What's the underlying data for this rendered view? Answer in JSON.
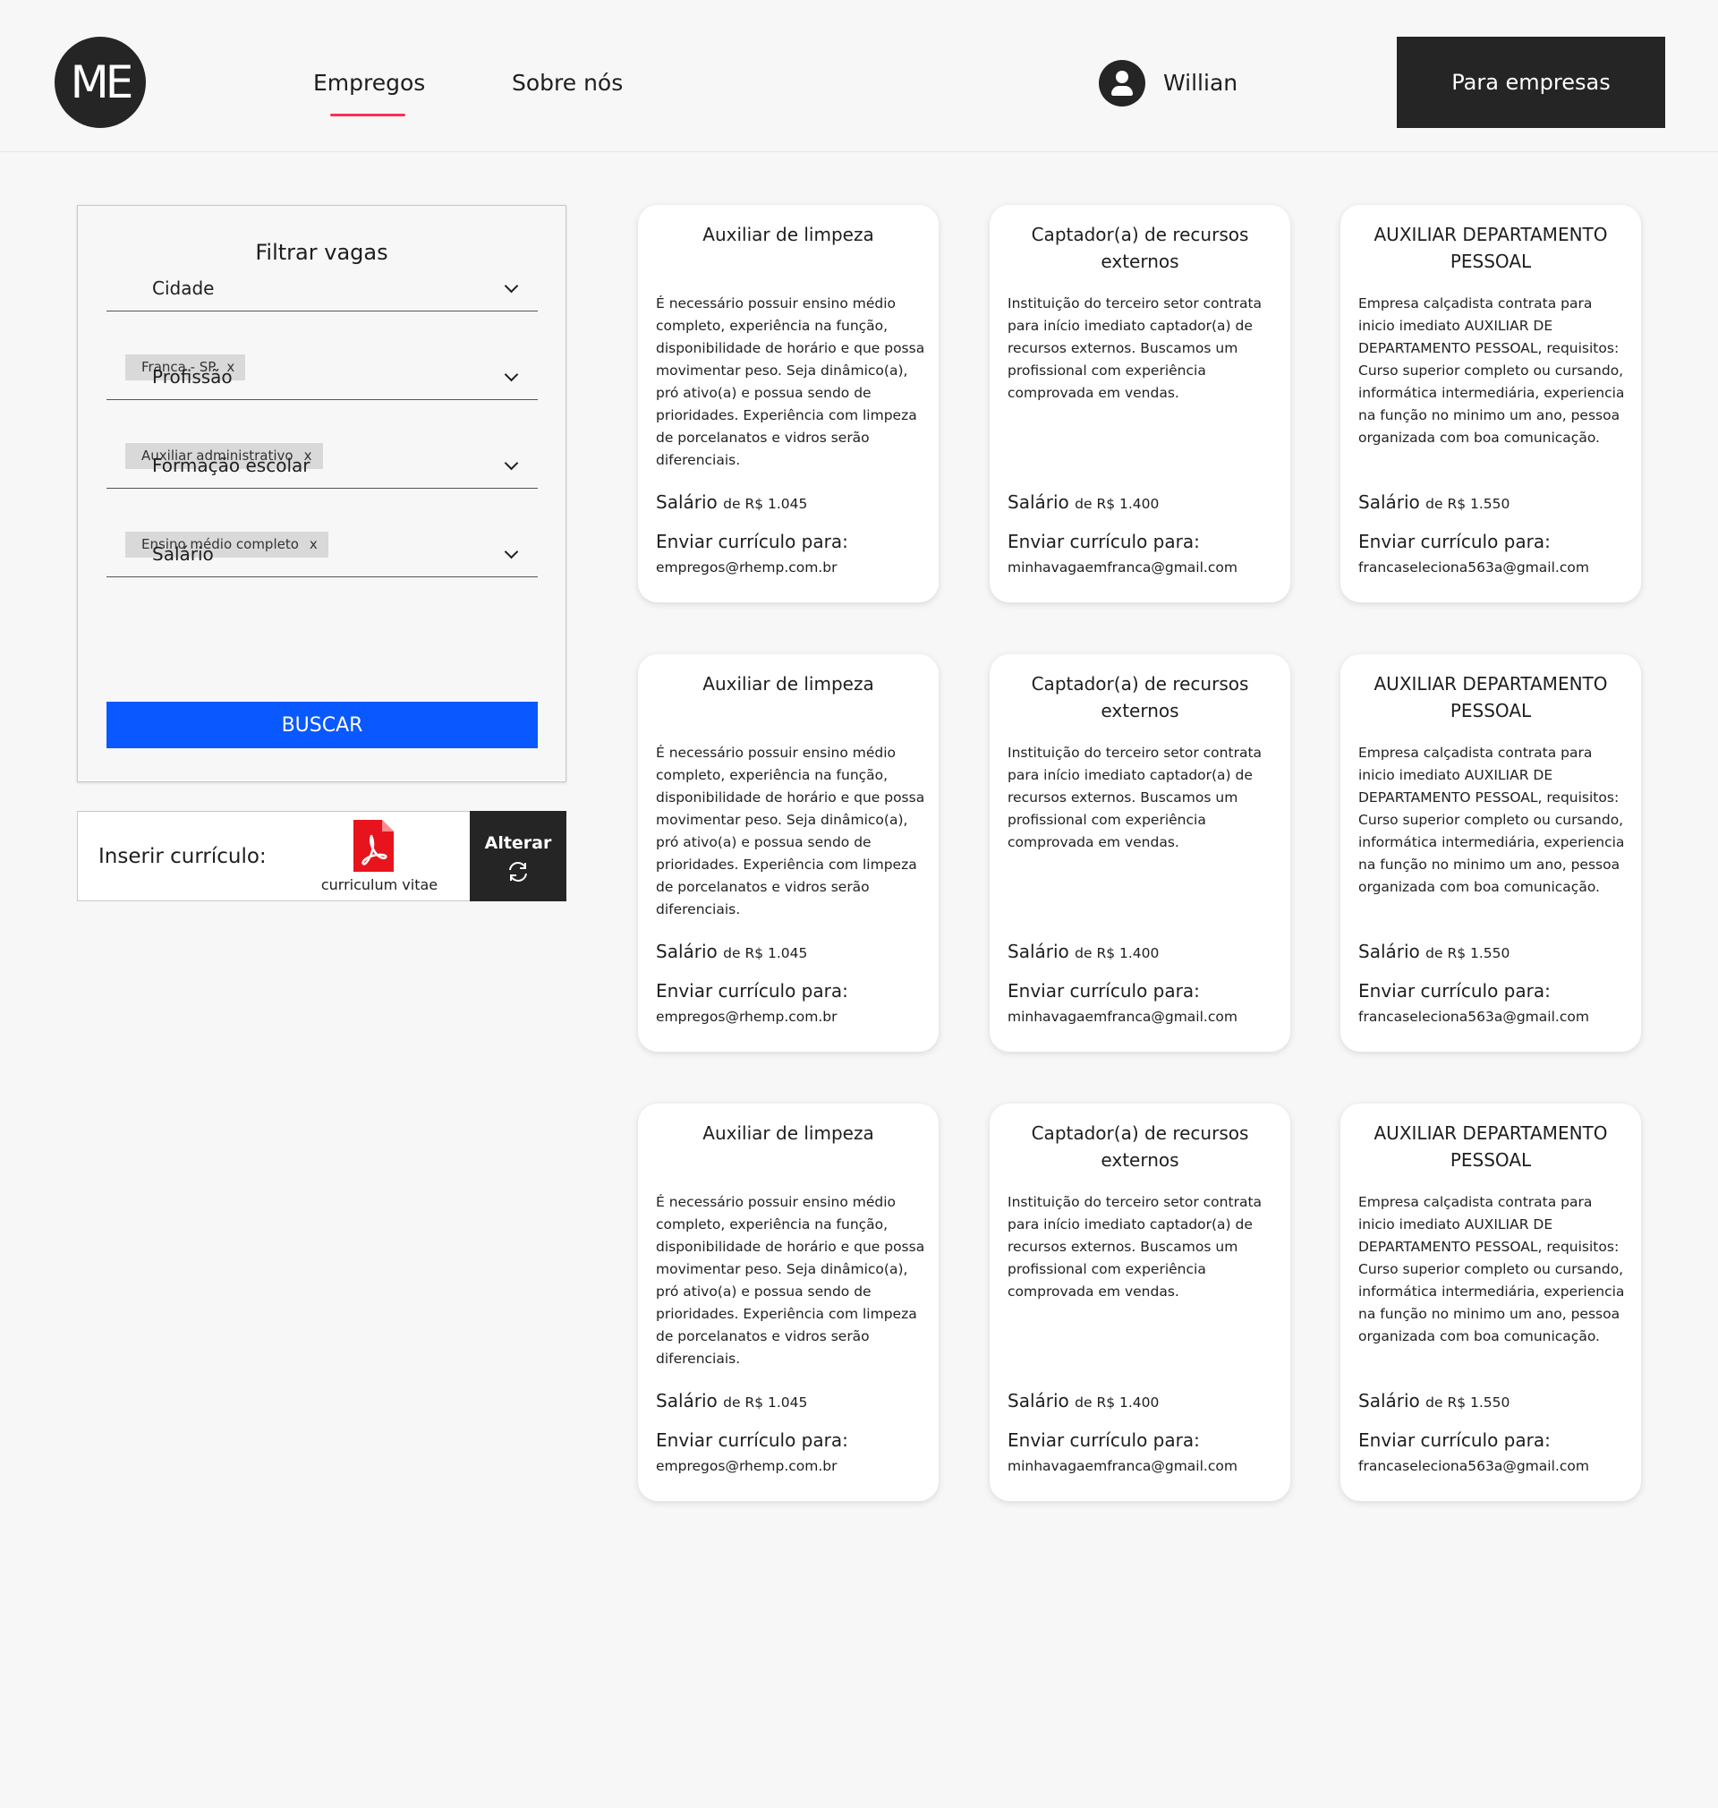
{
  "header": {
    "logo_text": "ME",
    "nav": [
      {
        "label": "Empregos",
        "active": true
      },
      {
        "label": "Sobre nós",
        "active": false
      }
    ],
    "user_name": "Willian",
    "cta_label": "Para empresas",
    "accent_color": "#ff2d55"
  },
  "filter": {
    "title": "Filtrar vagas",
    "fields": [
      {
        "label": "Cidade",
        "chip": "Franca - SP"
      },
      {
        "label": "Profissão",
        "chip": "Auxiliar administrativo"
      },
      {
        "label": "Formação escolar",
        "chip": "Ensino médio completo"
      },
      {
        "label": "Salário",
        "chip": null
      }
    ],
    "chip_remove": "x",
    "search_label": "BUSCAR",
    "search_color": "#0a58ff"
  },
  "cv": {
    "label": "Inserir currículo:",
    "file_name": "curriculum vitae",
    "change_label": "Alterar"
  },
  "job_labels": {
    "salary": "Salário",
    "send_to": "Enviar currículo para:"
  },
  "jobs": [
    {
      "title": "Auxiliar de limpeza",
      "description": "É necessário possuir ensino médio completo, experiência na função, disponibilidade de horário e que possa movimentar peso. Seja dinâmico(a), pró ativo(a) e possua sendo de prioridades. Experiência com limpeza de porcelanatos e vidros serão diferenciais.",
      "salary": "de R$ 1.045",
      "email": "empregos@rhemp.com.br"
    },
    {
      "title": "Captador(a) de recursos externos",
      "description": "Instituição do terceiro setor contrata para início imediato captador(a) de recursos externos. Buscamos um profissional com experiência comprovada em vendas.",
      "salary": "de R$ 1.400",
      "email": "minhavagaemfranca@gmail.com"
    },
    {
      "title": "AUXILIAR DEPARTAMENTO PESSOAL",
      "description": "Empresa calçadista contrata para inicio imediato AUXILIAR DE DEPARTAMENTO PESSOAL, requisitos: Curso superior completo ou cursando, informática intermediária, experiencia na função no minimo um ano, pessoa organizada com boa comunicação.",
      "salary": "de R$ 1.550",
      "email": "francaseleciona563a@gmail.com"
    },
    {
      "title": "Auxiliar de limpeza",
      "description": "É necessário possuir ensino médio completo, experiência na função, disponibilidade de horário e que possa movimentar peso. Seja dinâmico(a), pró ativo(a) e possua sendo de prioridades. Experiência com limpeza de porcelanatos e vidros serão diferenciais.",
      "salary": "de R$ 1.045",
      "email": "empregos@rhemp.com.br"
    },
    {
      "title": "Captador(a) de recursos externos",
      "description": "Instituição do terceiro setor contrata para início imediato captador(a) de recursos externos. Buscamos um profissional com experiência comprovada em vendas.",
      "salary": "de R$ 1.400",
      "email": "minhavagaemfranca@gmail.com"
    },
    {
      "title": "AUXILIAR DEPARTAMENTO PESSOAL",
      "description": "Empresa calçadista contrata para inicio imediato AUXILIAR DE DEPARTAMENTO PESSOAL, requisitos: Curso superior completo ou cursando, informática intermediária, experiencia na função no minimo um ano, pessoa organizada com boa comunicação.",
      "salary": "de R$ 1.550",
      "email": "francaseleciona563a@gmail.com"
    },
    {
      "title": "Auxiliar de limpeza",
      "description": "É necessário possuir ensino médio completo, experiência na função, disponibilidade de horário e que possa movimentar peso. Seja dinâmico(a), pró ativo(a) e possua sendo de prioridades. Experiência com limpeza de porcelanatos e vidros serão diferenciais.",
      "salary": "de R$ 1.045",
      "email": "empregos@rhemp.com.br"
    },
    {
      "title": "Captador(a) de recursos externos",
      "description": "Instituição do terceiro setor contrata para início imediato captador(a) de recursos externos. Buscamos um profissional com experiência comprovada em vendas.",
      "salary": "de R$ 1.400",
      "email": "minhavagaemfranca@gmail.com"
    },
    {
      "title": "AUXILIAR DEPARTAMENTO PESSOAL",
      "description": "Empresa calçadista contrata para inicio imediato AUXILIAR DE DEPARTAMENTO PESSOAL, requisitos: Curso superior completo ou cursando, informática intermediária, experiencia na função no minimo um ano, pessoa organizada com boa comunicação.",
      "salary": "de R$ 1.550",
      "email": "francaseleciona563a@gmail.com"
    }
  ]
}
